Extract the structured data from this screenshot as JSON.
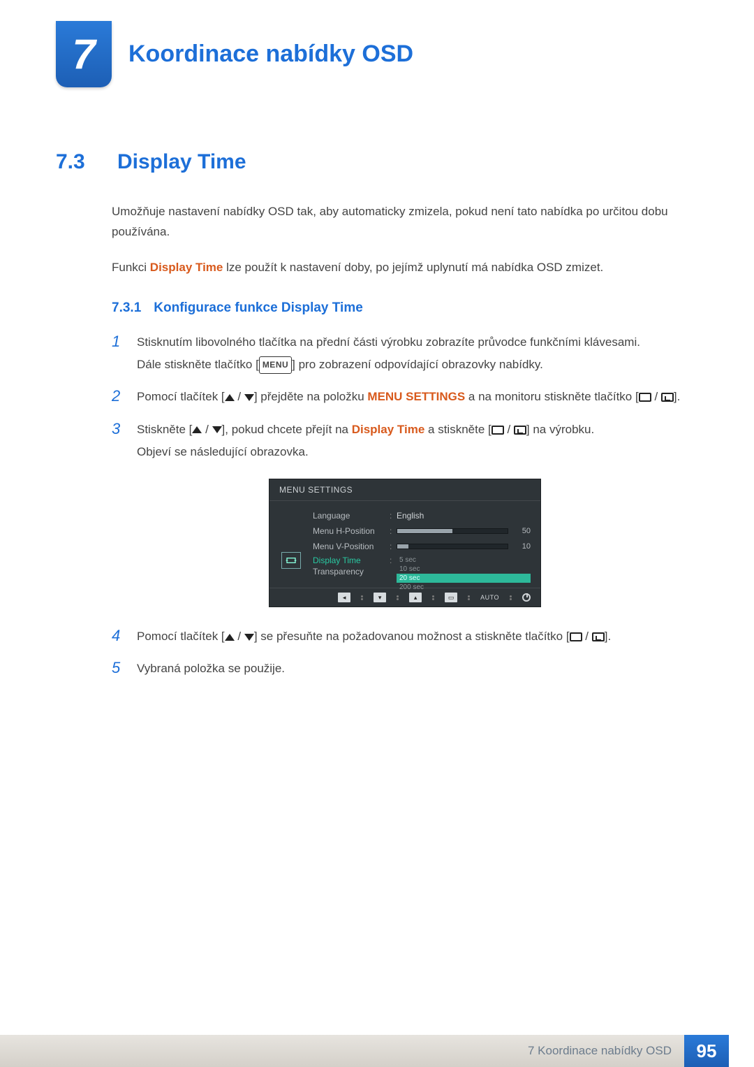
{
  "chapter": {
    "number": "7",
    "title": "Koordinace nabídky OSD"
  },
  "section": {
    "number": "7.3",
    "title": "Display Time"
  },
  "intro1": "Umožňuje nastavení nabídky OSD tak, aby automaticky zmizela, pokud není tato nabídka po určitou dobu používána.",
  "intro2_pre": "Funkci ",
  "intro2_kw": "Display Time",
  "intro2_post": " lze použít k nastavení doby, po jejímž uplynutí má nabídka OSD zmizet.",
  "subsection": {
    "number": "7.3.1",
    "title": "Konfigurace funkce Display Time"
  },
  "steps": {
    "s1": "Stisknutím libovolného tlačítka na přední části výrobku zobrazíte průvodce funkčními klávesami.",
    "s1b_pre": "Dále stiskněte tlačítko [",
    "s1b_menu": "MENU",
    "s1b_post": "] pro zobrazení odpovídající obrazovky nabídky.",
    "s2_pre": "Pomocí tlačítek [",
    "s2_mid": "] přejděte na položku ",
    "s2_kw": "MENU SETTINGS",
    "s2_post": " a na monitoru stiskněte tlačítko [",
    "s2_end": "].",
    "s3_pre": "Stiskněte [",
    "s3_mid1": "], pokud chcete přejít na ",
    "s3_kw": "Display Time",
    "s3_mid2": " a stiskněte [",
    "s3_post": "] na výrobku.",
    "s3b": "Objeví se následující obrazovka.",
    "s4_pre": "Pomocí tlačítek [",
    "s4_mid": "] se přesuňte na požadovanou možnost a stiskněte tlačítko [",
    "s4_end": "].",
    "s5": "Vybraná položka se použije."
  },
  "osd": {
    "title": "MENU SETTINGS",
    "rows": {
      "language": {
        "label": "Language",
        "value": "English"
      },
      "hpos": {
        "label": "Menu H-Position",
        "value": "50",
        "pct": 50
      },
      "vpos": {
        "label": "Menu V-Position",
        "value": "10",
        "pct": 10
      },
      "display_time": {
        "label": "Display Time"
      },
      "transparency": {
        "label": "Transparency"
      }
    },
    "options": [
      "5 sec",
      "10 sec",
      "20 sec",
      "200 sec"
    ],
    "highlight_index": 2,
    "nav_auto": "AUTO"
  },
  "footer": {
    "text": "7 Koordinace nabídky OSD",
    "page": "95"
  }
}
